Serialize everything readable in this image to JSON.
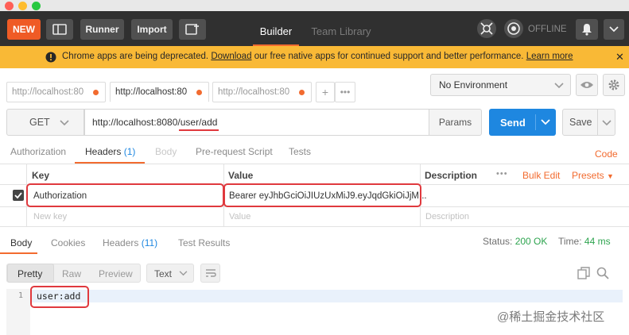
{
  "header": {
    "new_label": "NEW",
    "runner_label": "Runner",
    "import_label": "Import",
    "tabs": [
      {
        "label": "Builder"
      },
      {
        "label": "Team Library"
      }
    ],
    "offline_label": "OFFLINE"
  },
  "banner": {
    "text_before": "Chrome apps are being deprecated.",
    "download_link": "Download",
    "text_after": "our free native apps for continued support and better performance.",
    "learn_more": "Learn more"
  },
  "request_tabs": [
    {
      "label": "http://localhost:80"
    },
    {
      "label": "http://localhost:80"
    },
    {
      "label": "http://localhost:80"
    }
  ],
  "environment": {
    "selected": "No Environment"
  },
  "request": {
    "method": "GET",
    "url_prefix": "http://localhost:8080/",
    "url_path": "user/add",
    "params_label": "Params",
    "send_label": "Send",
    "save_label": "Save"
  },
  "request_subtabs": [
    {
      "label": "Authorization"
    },
    {
      "label": "Headers",
      "count": "(1)"
    },
    {
      "label": "Body"
    },
    {
      "label": "Pre-request Script"
    },
    {
      "label": "Tests"
    }
  ],
  "code_link": "Code",
  "headers_table": {
    "columns": [
      "Key",
      "Value",
      "Description"
    ],
    "bulk_edit": "Bulk Edit",
    "presets": "Presets",
    "rows": [
      {
        "key": "Authorization",
        "value": "Bearer eyJhbGciOiJIUzUxMiJ9.eyJqdGkiOiJjM..."
      }
    ],
    "placeholders": {
      "key": "New key",
      "value": "Value",
      "description": "Description"
    }
  },
  "response": {
    "tabs": [
      {
        "label": "Body"
      },
      {
        "label": "Cookies"
      },
      {
        "label": "Headers",
        "count": "(11)"
      },
      {
        "label": "Test Results"
      }
    ],
    "status_label": "Status:",
    "status_value": "200 OK",
    "time_label": "Time:",
    "time_value": "44 ms",
    "view_modes": [
      "Pretty",
      "Raw",
      "Preview"
    ],
    "format": "Text",
    "line_number": "1",
    "body": "user:add"
  },
  "watermark": "@稀土掘金技术社区",
  "colors": {
    "brand_orange": "#ef5b25",
    "send_blue": "#1e87e0",
    "banner_yellow": "#f9b936",
    "highlight_red": "#e0393e",
    "status_green": "#2ea44f"
  }
}
